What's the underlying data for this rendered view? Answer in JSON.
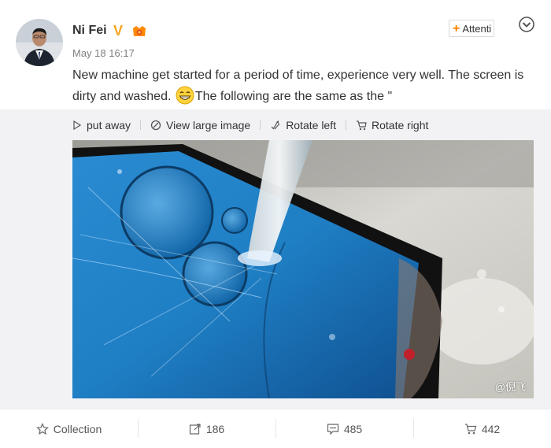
{
  "post": {
    "author": "Ni Fei",
    "time": "May 18 16:17",
    "follow_label": "Attenti",
    "text_before_emoji": "New machine get started for a period of time, experience very well. The screen is dirty and washed.",
    "text_after_emoji": "The following are the same as the \"",
    "verified_badge": "V"
  },
  "media_toolbar": {
    "put_away": "put away",
    "view_large": "View large image",
    "rotate_left": "Rotate left",
    "rotate_right": "Rotate right"
  },
  "photo": {
    "watermark": "@倪飞"
  },
  "footer": {
    "collection": "Collection",
    "forward_count": "186",
    "comment_count": "485",
    "like_count": "442"
  },
  "colors": {
    "accent": "#ff8200",
    "verified": "#f5a623",
    "screen_blue": "#1f7fc4"
  }
}
